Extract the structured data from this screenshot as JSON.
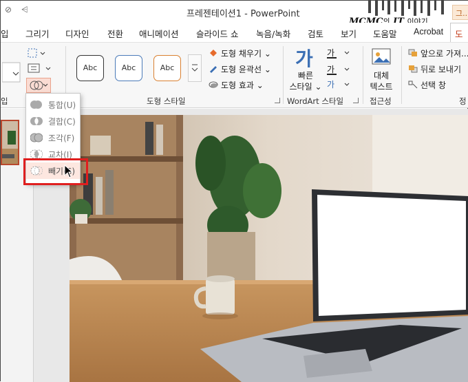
{
  "window": {
    "title": "프레젠테이션1 - PowerPoint",
    "watermark_brand": "MCMC",
    "watermark_of": "의",
    "watermark_it": "IT",
    "watermark_story": "이야기",
    "contextual_tab_fragment": "그..."
  },
  "tabs": [
    {
      "label": "입"
    },
    {
      "label": "그리기"
    },
    {
      "label": "디자인"
    },
    {
      "label": "전환"
    },
    {
      "label": "애니메이션"
    },
    {
      "label": "슬라이드 쇼"
    },
    {
      "label": "녹음/녹화"
    },
    {
      "label": "검토"
    },
    {
      "label": "보기"
    },
    {
      "label": "도움말"
    },
    {
      "label": "Acrobat"
    },
    {
      "label": "도"
    }
  ],
  "ribbon": {
    "shape_styles": {
      "label": "도형 스타일",
      "gallery": [
        "Abc",
        "Abc",
        "Abc"
      ],
      "fill": "도형 채우기",
      "outline": "도형 윤곽선",
      "effects": "도형 효과"
    },
    "wordart": {
      "label": "WordArt 스타일",
      "quick_styles_line1": "빠른",
      "quick_styles_line2": "스타일",
      "glyph": "가"
    },
    "accessibility": {
      "label": "접근성",
      "alt_text_line1": "대체",
      "alt_text_line2": "텍스트"
    },
    "arrange": {
      "label_fragment": "정",
      "bring_forward": "앞으로 가져...",
      "send_backward": "뒤로 보내기",
      "selection_pane": "선택 창"
    },
    "insert_shapes_label_fragment": "입"
  },
  "merge_menu": {
    "items": [
      {
        "label": "통합(U)",
        "icon": "union-icon"
      },
      {
        "label": "결합(C)",
        "icon": "combine-icon"
      },
      {
        "label": "조각(F)",
        "icon": "fragment-icon"
      },
      {
        "label": "교차(I)",
        "icon": "intersect-icon"
      },
      {
        "label": "빼기(S)",
        "icon": "subtract-icon",
        "highlighted": true
      }
    ]
  },
  "colors": {
    "accent": "#c43e1c",
    "highlight_box": "#e01e1e",
    "menu_hover": "#fde7e0"
  }
}
